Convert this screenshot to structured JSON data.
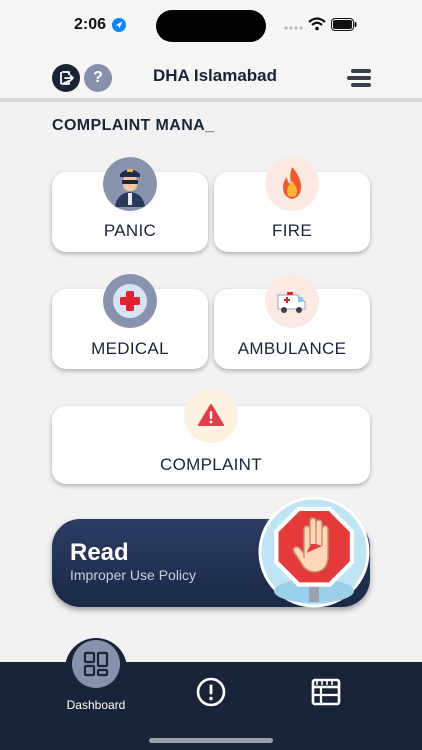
{
  "status_bar": {
    "time": "2:06"
  },
  "header": {
    "title": "DHA Islamabad",
    "help_label": "?"
  },
  "section": {
    "title": "COMPLAINT MANA_"
  },
  "cards": {
    "panic": "PANIC",
    "fire": "FIRE",
    "medical": "MEDICAL",
    "ambulance": "AMBULANCE",
    "complaint": "COMPLAINT"
  },
  "banner": {
    "title": "Read",
    "subtitle": "Improper Use Policy"
  },
  "nav": {
    "dashboard_label": "Dashboard"
  },
  "icons": {
    "status": [
      "location-arrow-icon",
      "signal-icon",
      "wifi-icon",
      "battery-icon"
    ],
    "header": [
      "logout-icon",
      "help-icon",
      "menu-icon"
    ],
    "cards": [
      "security-guard-icon",
      "fire-icon",
      "medical-cross-icon",
      "ambulance-icon",
      "warning-icon"
    ],
    "banner": "stop-hand-icon",
    "nav": [
      "dashboard-icon",
      "alert-icon",
      "board-icon"
    ]
  },
  "colors": {
    "navy": "#1b2437",
    "accent_gray": "#8791ab",
    "warning_red": "#e0404a",
    "fire_orange": "#f05a2a"
  }
}
